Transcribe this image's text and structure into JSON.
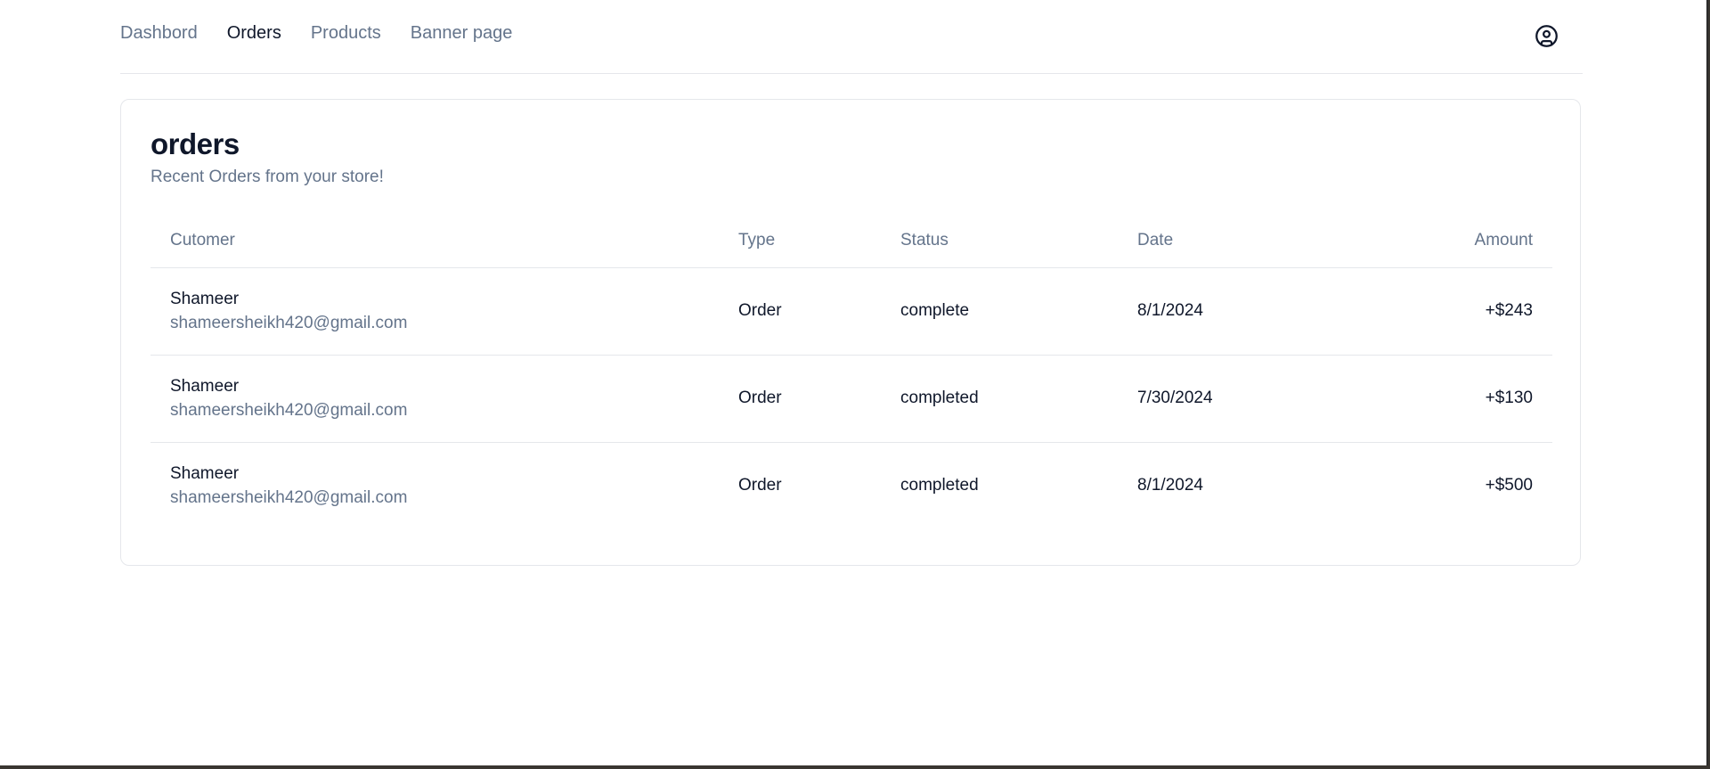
{
  "nav": {
    "links": [
      "Dashbord",
      "Orders",
      "Products",
      "Banner page"
    ],
    "active": "Orders",
    "user_icon": "user-circle-icon"
  },
  "card": {
    "title": "orders",
    "subtitle": "Recent Orders from your store!"
  },
  "table": {
    "headers": [
      "Cutomer",
      "Type",
      "Status",
      "Date",
      "Amount"
    ],
    "rows": [
      {
        "name": "Shameer",
        "email": "shameersheikh420@gmail.com",
        "type": "Order",
        "status": "complete",
        "date": "8/1/2024",
        "amount": "+$243"
      },
      {
        "name": "Shameer",
        "email": "shameersheikh420@gmail.com",
        "type": "Order",
        "status": "completed",
        "date": "7/30/2024",
        "amount": "+$130"
      },
      {
        "name": "Shameer",
        "email": "shameersheikh420@gmail.com",
        "type": "Order",
        "status": "completed",
        "date": "8/1/2024",
        "amount": "+$500"
      }
    ]
  },
  "colors": {
    "text": "#0f172a",
    "muted": "#64748b",
    "border": "#e5e7eb"
  }
}
